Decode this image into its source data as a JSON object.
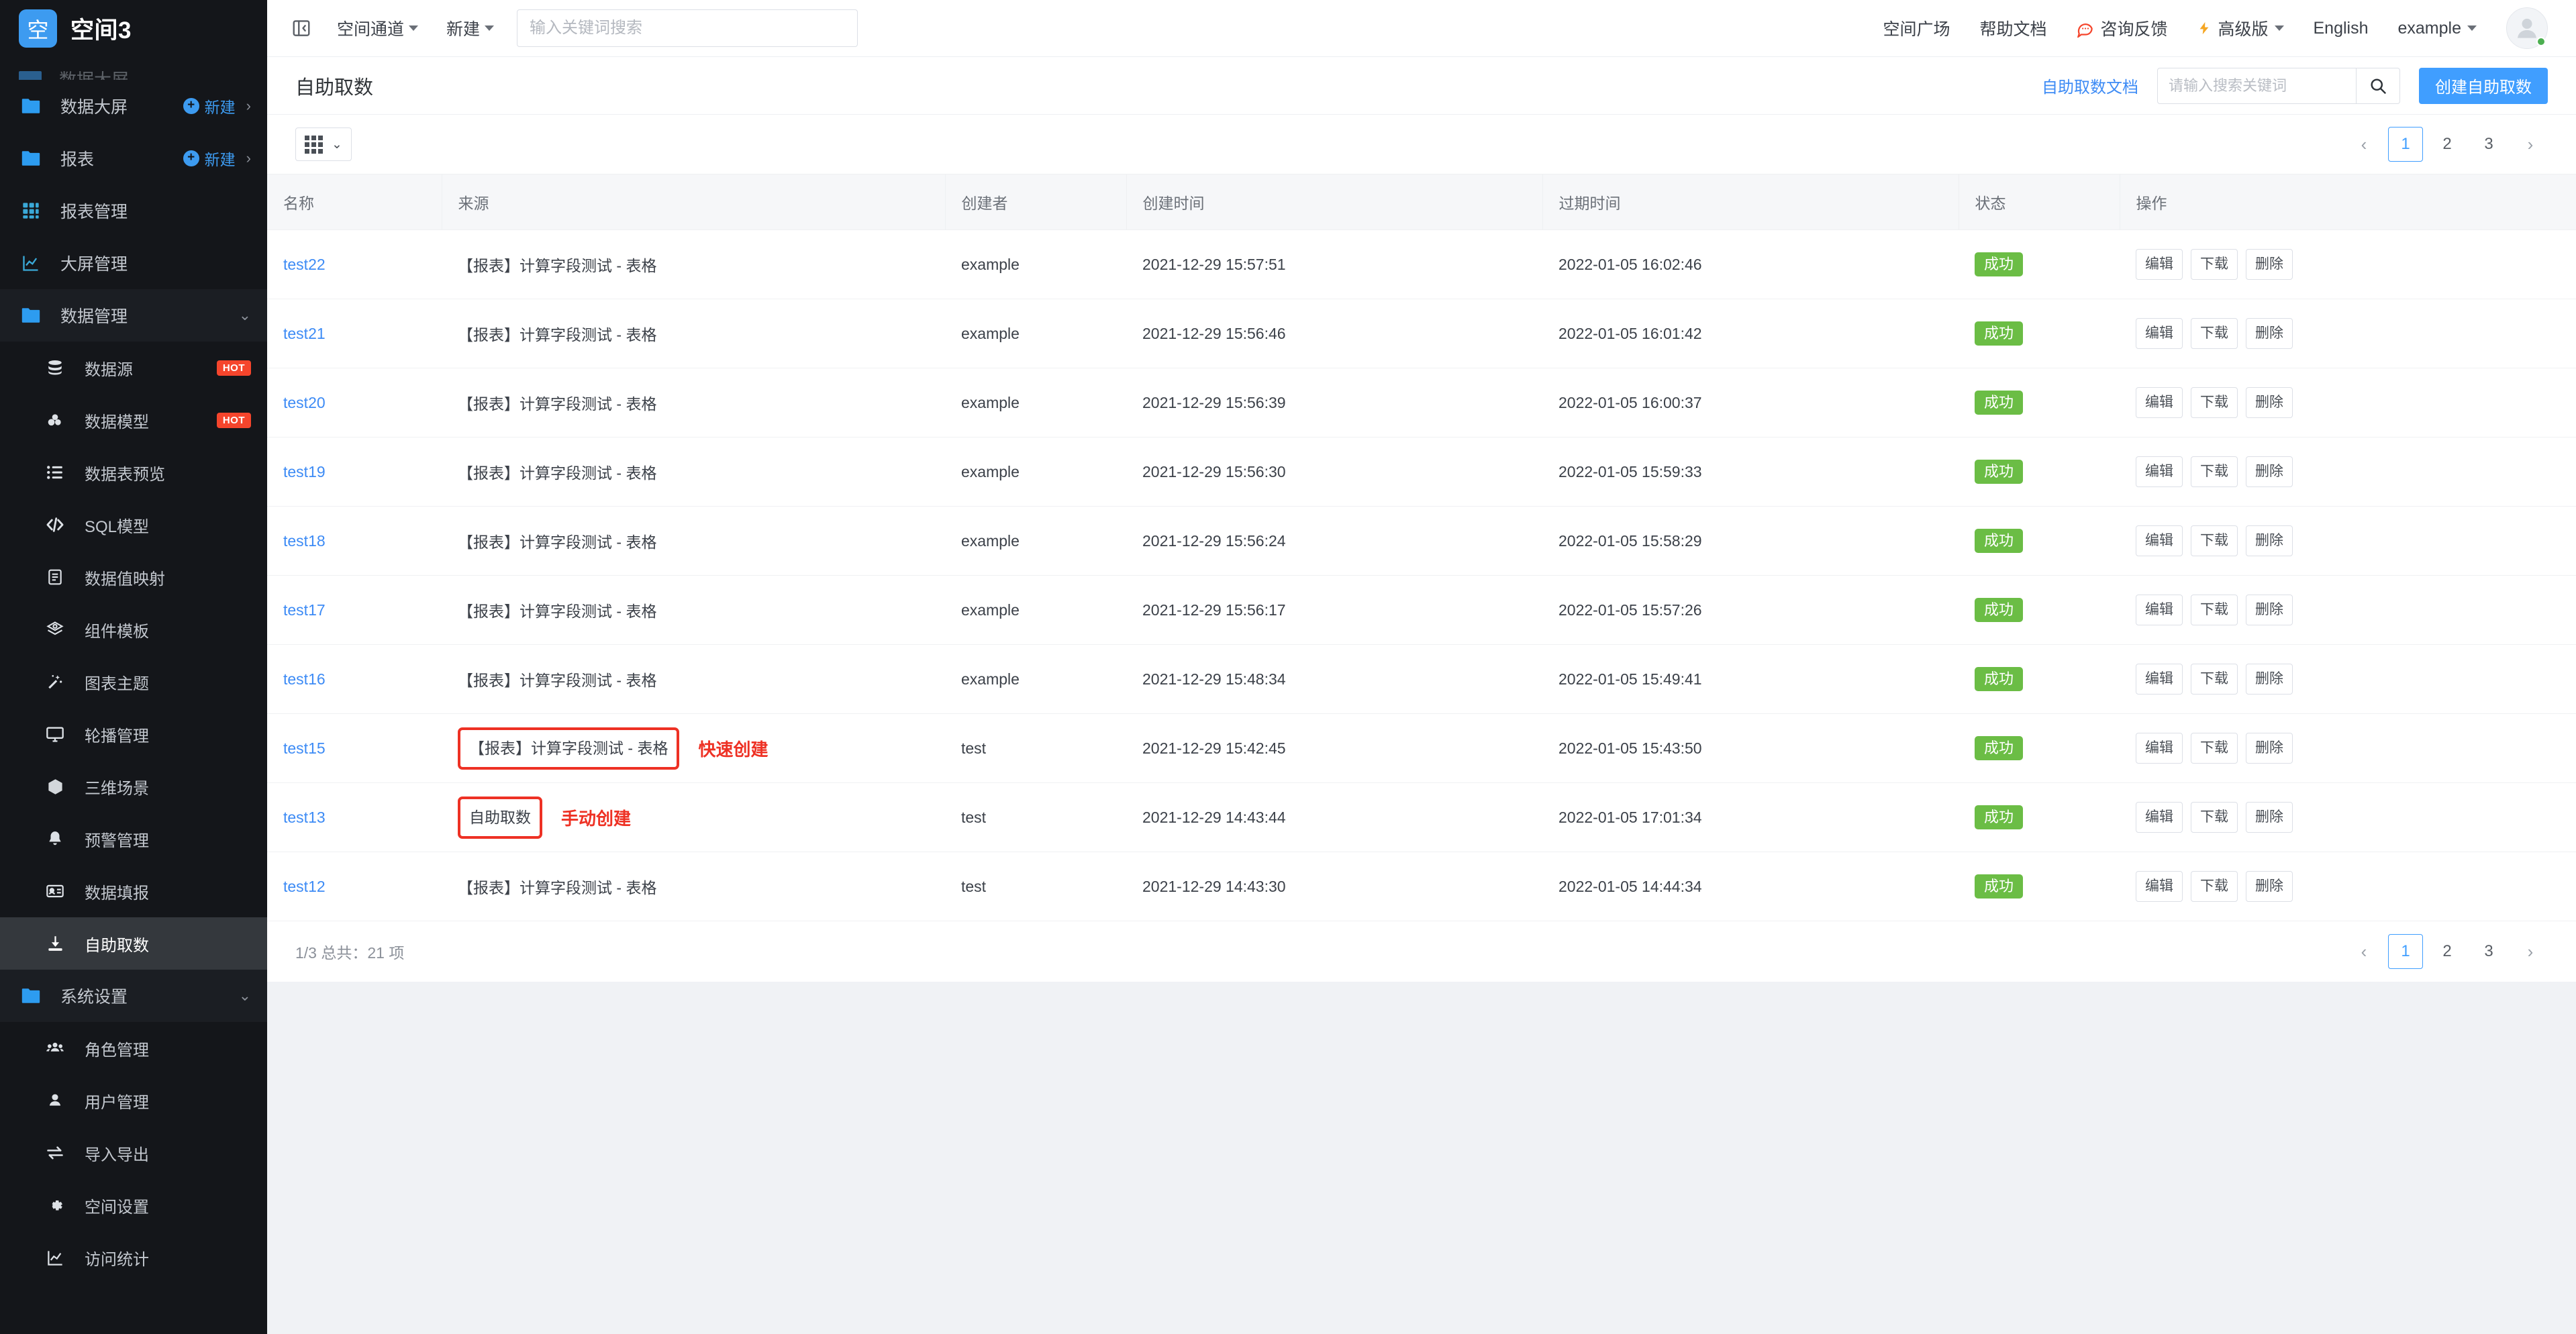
{
  "sidebar": {
    "brand": {
      "logo_text": "空",
      "title": "空间3"
    },
    "clipped_item_label": "数据大屏",
    "new_label": "新建",
    "hot_badge": "HOT",
    "groups": [
      {
        "label": "数据大屏",
        "icon": "folder-icon",
        "has_new": true,
        "has_arrow": true
      },
      {
        "label": "报表",
        "icon": "folder-icon",
        "has_new": true,
        "has_arrow": true
      }
    ],
    "items": [
      {
        "label": "报表管理",
        "icon": "grid-icon"
      },
      {
        "label": "大屏管理",
        "icon": "chart-line-icon"
      },
      {
        "label": "数据管理",
        "icon": "folder-icon",
        "group": true,
        "expanded": true
      },
      {
        "label": "数据源",
        "icon": "database-icon",
        "sub": true,
        "badge": "HOT"
      },
      {
        "label": "数据模型",
        "icon": "model-icon",
        "sub": true,
        "badge": "HOT"
      },
      {
        "label": "数据表预览",
        "icon": "list-icon",
        "sub": true
      },
      {
        "label": "SQL模型",
        "icon": "code-icon",
        "sub": true
      },
      {
        "label": "数据值映射",
        "icon": "mapping-icon",
        "sub": true
      },
      {
        "label": "组件模板",
        "icon": "box-template-icon",
        "sub": true
      },
      {
        "label": "图表主题",
        "icon": "magic-wand-icon",
        "sub": true
      },
      {
        "label": "轮播管理",
        "icon": "monitor-icon",
        "sub": true
      },
      {
        "label": "三维场景",
        "icon": "cube-icon",
        "sub": true
      },
      {
        "label": "预警管理",
        "icon": "bell-icon",
        "sub": true
      },
      {
        "label": "数据填报",
        "icon": "id-card-icon",
        "sub": true
      },
      {
        "label": "自助取数",
        "icon": "download-icon",
        "sub": true,
        "active": true
      },
      {
        "label": "系统设置",
        "icon": "folder-icon",
        "group": true,
        "expanded": true
      },
      {
        "label": "角色管理",
        "icon": "users-icon",
        "sub": true
      },
      {
        "label": "用户管理",
        "icon": "user-icon",
        "sub": true
      },
      {
        "label": "导入导出",
        "icon": "exchange-icon",
        "sub": true
      },
      {
        "label": "空间设置",
        "icon": "gear-icon",
        "sub": true
      },
      {
        "label": "访问统计",
        "icon": "chart-line-icon",
        "sub": true
      }
    ]
  },
  "topbar": {
    "collapse_icon": "collapse-sidebar-icon",
    "menu": [
      {
        "label": "空间通道",
        "caret": true
      },
      {
        "label": "新建",
        "caret": true
      }
    ],
    "search": {
      "value": "",
      "placeholder": "输入关键词搜索"
    },
    "right": [
      {
        "label": "空间广场",
        "icon": null
      },
      {
        "label": "帮助文档",
        "icon": null
      },
      {
        "label": "咨询反馈",
        "icon": "chat-icon"
      },
      {
        "label": "高级版",
        "icon": "bolt-icon",
        "caret": true
      },
      {
        "label": "English",
        "icon": null
      },
      {
        "label": "example",
        "icon": null,
        "caret": true
      }
    ],
    "avatar": "user-avatar"
  },
  "pagehead": {
    "title": "自助取数",
    "doc_link": "自助取数文档",
    "search": {
      "value": "",
      "placeholder": "请输入搜索关键词"
    },
    "search_icon": "search-icon",
    "create_button": "创建自助取数"
  },
  "toolbar": {
    "view_toggle_icon": "grid-view-icon",
    "view_toggle_chevron": "chevron-down-icon"
  },
  "pagination": {
    "prev": "‹",
    "next": "›",
    "pages": [
      "1",
      "2",
      "3"
    ],
    "current": "1"
  },
  "table": {
    "columns": [
      "名称",
      "来源",
      "创建者",
      "创建时间",
      "过期时间",
      "状态",
      "操作"
    ],
    "actions": [
      "编辑",
      "下载",
      "删除"
    ],
    "rows": [
      {
        "name": "test22",
        "source": "【报表】计算字段测试 - 表格",
        "creator": "example",
        "created": "2021-12-29 15:57:51",
        "expires": "2022-01-05 16:02:46",
        "status": "成功"
      },
      {
        "name": "test21",
        "source": "【报表】计算字段测试 - 表格",
        "creator": "example",
        "created": "2021-12-29 15:56:46",
        "expires": "2022-01-05 16:01:42",
        "status": "成功"
      },
      {
        "name": "test20",
        "source": "【报表】计算字段测试 - 表格",
        "creator": "example",
        "created": "2021-12-29 15:56:39",
        "expires": "2022-01-05 16:00:37",
        "status": "成功"
      },
      {
        "name": "test19",
        "source": "【报表】计算字段测试 - 表格",
        "creator": "example",
        "created": "2021-12-29 15:56:30",
        "expires": "2022-01-05 15:59:33",
        "status": "成功"
      },
      {
        "name": "test18",
        "source": "【报表】计算字段测试 - 表格",
        "creator": "example",
        "created": "2021-12-29 15:56:24",
        "expires": "2022-01-05 15:58:29",
        "status": "成功"
      },
      {
        "name": "test17",
        "source": "【报表】计算字段测试 - 表格",
        "creator": "example",
        "created": "2021-12-29 15:56:17",
        "expires": "2022-01-05 15:57:26",
        "status": "成功"
      },
      {
        "name": "test16",
        "source": "【报表】计算字段测试 - 表格",
        "creator": "example",
        "created": "2021-12-29 15:48:34",
        "expires": "2022-01-05 15:49:41",
        "status": "成功"
      },
      {
        "name": "test15",
        "source": "【报表】计算字段测试 - 表格",
        "creator": "test",
        "created": "2021-12-29 15:42:45",
        "expires": "2022-01-05 15:43:50",
        "status": "成功",
        "annotation": "快速创建"
      },
      {
        "name": "test13",
        "source": "自助取数",
        "creator": "test",
        "created": "2021-12-29 14:43:44",
        "expires": "2022-01-05 17:01:34",
        "status": "成功",
        "annotation": "手动创建"
      },
      {
        "name": "test12",
        "source": "【报表】计算字段测试 - 表格",
        "creator": "test",
        "created": "2021-12-29 14:43:30",
        "expires": "2022-01-05 14:44:34",
        "status": "成功"
      }
    ]
  },
  "footer": {
    "summary": "1/3 总共：21 项"
  },
  "colors": {
    "accent": "#409eff",
    "link": "#3d8bf5",
    "success": "#6bbd45",
    "annotation": "#ee3124",
    "hot": "#f5452c",
    "sidebar_bg": "#14161a"
  }
}
